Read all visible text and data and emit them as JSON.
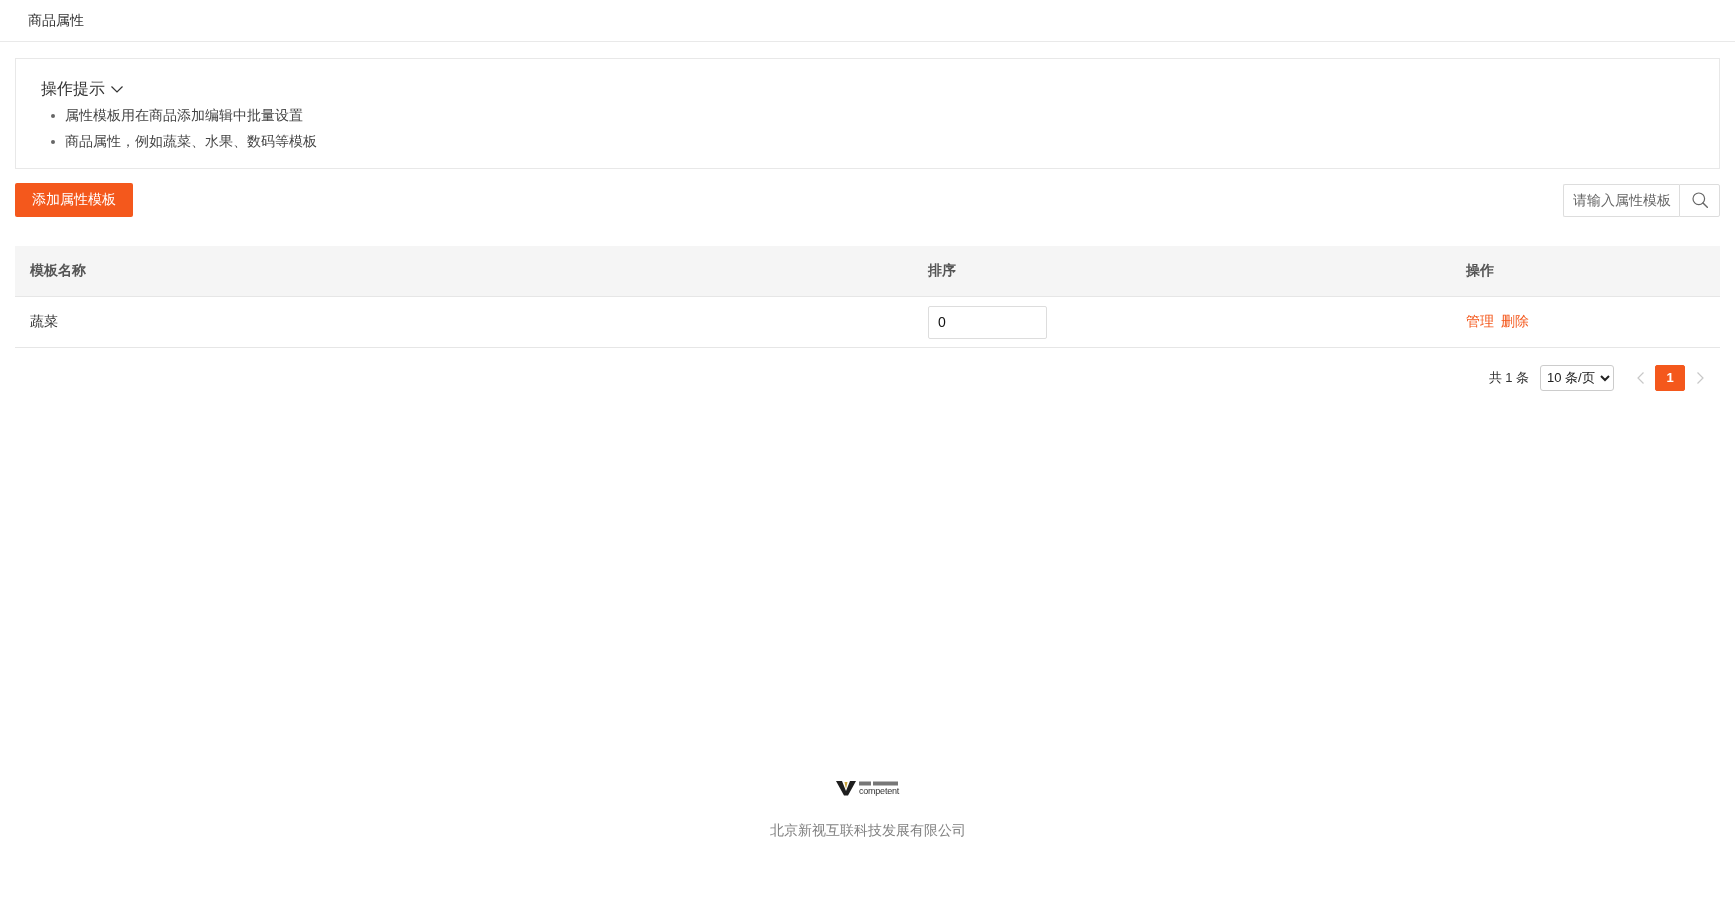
{
  "header": {
    "title": "商品属性"
  },
  "tips": {
    "title": "操作提示",
    "expanded": true,
    "items": [
      "属性模板用在商品添加编辑中批量设置",
      "商品属性，例如蔬菜、水果、数码等模板"
    ]
  },
  "toolbar": {
    "add_button": "添加属性模板",
    "search": {
      "placeholder": "请输入属性模板"
    }
  },
  "table": {
    "columns": [
      "模板名称",
      "排序",
      "操作"
    ],
    "rows": [
      {
        "name": "蔬菜",
        "sort": "0",
        "actions": [
          "管理",
          "删除"
        ]
      }
    ]
  },
  "pagination": {
    "total": "共 1 条",
    "page_size": "10 条/页",
    "pages": [
      {
        "label": "1",
        "selected": true
      }
    ]
  },
  "footer": {
    "logo_text": "competent",
    "company": "北京新视互联科技发展有限公司"
  }
}
